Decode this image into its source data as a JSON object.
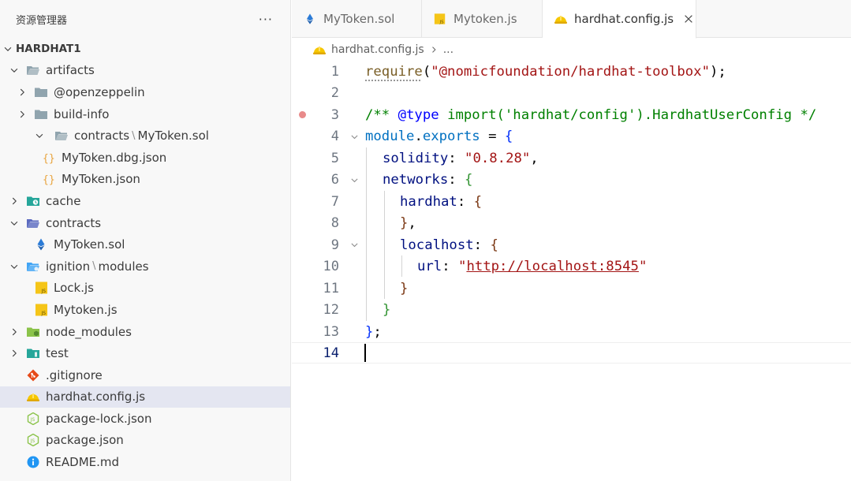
{
  "explorer": {
    "title": "资源管理器",
    "more": "···",
    "root": "HARDHAT1",
    "items": [
      {
        "label": "artifacts",
        "kind": "folder-open",
        "depth": 1
      },
      {
        "label": "@openzeppelin",
        "kind": "folder",
        "depth": 2
      },
      {
        "label": "build-info",
        "kind": "folder",
        "depth": 2
      },
      {
        "label": "contracts",
        "label2": "MyToken.sol",
        "kind": "folder-open",
        "depth": 2
      },
      {
        "label": "MyToken.dbg.json",
        "kind": "json",
        "depth": 3
      },
      {
        "label": "MyToken.json",
        "kind": "json",
        "depth": 3
      },
      {
        "label": "cache",
        "kind": "folder-cache",
        "depth": 1
      },
      {
        "label": "contracts",
        "kind": "folder-contracts",
        "depth": 1
      },
      {
        "label": "MyToken.sol",
        "kind": "sol",
        "depth": 2
      },
      {
        "label": "ignition",
        "label2": "modules",
        "kind": "folder-ignition",
        "depth": 1
      },
      {
        "label": "Lock.js",
        "kind": "js",
        "depth": 2
      },
      {
        "label": "Mytoken.js",
        "kind": "js",
        "depth": 2
      },
      {
        "label": "node_modules",
        "kind": "folder-node",
        "depth": 1
      },
      {
        "label": "test",
        "kind": "folder-test",
        "depth": 1
      },
      {
        "label": ".gitignore",
        "kind": "git",
        "depth": 1
      },
      {
        "label": "hardhat.config.js",
        "kind": "hardhat",
        "depth": 1
      },
      {
        "label": "package-lock.json",
        "kind": "node-json",
        "depth": 1
      },
      {
        "label": "package.json",
        "kind": "node-json",
        "depth": 1
      },
      {
        "label": "README.md",
        "kind": "info",
        "depth": 1
      }
    ]
  },
  "tabs": [
    {
      "label": "MyToken.sol"
    },
    {
      "label": "Mytoken.js"
    },
    {
      "label": "hardhat.config.js"
    }
  ],
  "breadcrumb": {
    "file": "hardhat.config.js",
    "more": "..."
  },
  "editor": {
    "line_numbers": [
      "1",
      "2",
      "3",
      "4",
      "5",
      "6",
      "7",
      "8",
      "9",
      "10",
      "11",
      "12",
      "13",
      "14"
    ],
    "code": {
      "l1_fn": "require",
      "l1_open": "(",
      "l1_str": "\"@nomicfoundation/hardhat-toolbox\"",
      "l1_close": ");",
      "l3_a": "/** ",
      "l3_tag": "@type",
      "l3_b": " ",
      "l3_type": "import('hardhat/config').HardhatUserConfig",
      "l3_c": " */",
      "l4_obj": "module",
      "l4_dot": ".",
      "l4_exp": "exports",
      "l4_eq": " = ",
      "l4_brace": "{",
      "l5_key": "solidity",
      "l5_colon": ": ",
      "l5_str": "\"0.8.28\"",
      "l5_comma": ",",
      "l6_key": "networks",
      "l6_colon": ": ",
      "l6_brace": "{",
      "l7_key": "hardhat",
      "l7_colon": ": ",
      "l7_brace": "{",
      "l8_brace": "}",
      "l8_comma": ",",
      "l9_key": "localhost",
      "l9_colon": ": ",
      "l9_brace": "{",
      "l10_key": "url",
      "l10_colon": ": ",
      "l10_q1": "\"",
      "l10_url": "http://localhost:8545",
      "l10_q2": "\"",
      "l11_brace": "}",
      "l12_brace": "}",
      "l13_brace": "}",
      "l13_semi": ";"
    }
  },
  "colors": {
    "selection": "#e4e6f1",
    "sol_icon": "#2b7bd6",
    "js_icon": "#f5c518",
    "hardhat_icon": "#f6c700",
    "breakpoint": "#e88a8a"
  }
}
